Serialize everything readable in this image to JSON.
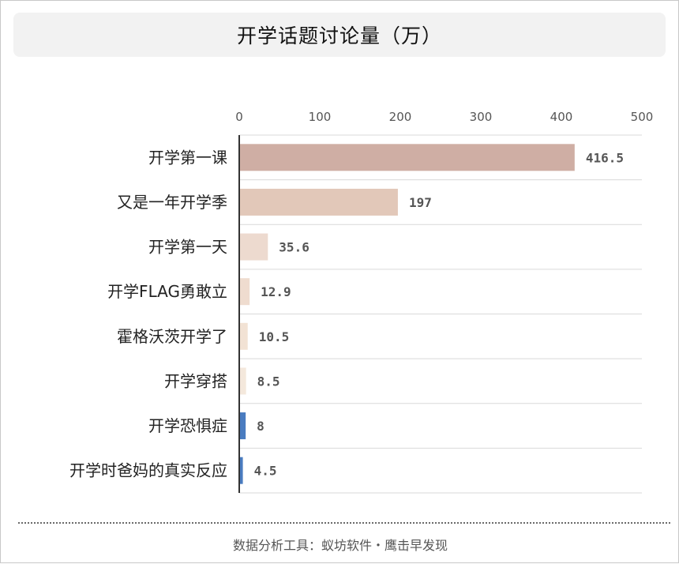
{
  "chart_data": {
    "type": "bar",
    "orientation": "horizontal",
    "title": "开学话题讨论量（万）",
    "categories": [
      "开学第一课",
      "又是一年开学季",
      "开学第一天",
      "开学FLAG勇敢立",
      "霍格沃茨开学了",
      "开学穿搭",
      "开学恐惧症",
      "开学时爸妈的真实反应"
    ],
    "values": [
      416.5,
      197,
      35.6,
      12.9,
      10.5,
      8.5,
      8,
      4.5
    ],
    "data_labels": [
      "416.5",
      "197",
      "35.6",
      "12.9",
      "10.5",
      "8.5",
      "8",
      "4.5"
    ],
    "bar_colors": [
      "#cfaea4",
      "#e2c8b9",
      "#eddacf",
      "#efdccf",
      "#f2e2d4",
      "#f4e8dc",
      "#4a7cc0",
      "#4a7cc0"
    ],
    "xlim": [
      0,
      500
    ],
    "x_ticks": [
      0,
      100,
      200,
      300,
      400,
      500
    ],
    "tick_labels": [
      "0",
      "100",
      "200",
      "300",
      "400",
      "500"
    ],
    "axis_position": "top",
    "grid": true,
    "legend": "none"
  },
  "footer": {
    "source": "数据分析工具：蚁坊软件・鹰击早发现"
  }
}
